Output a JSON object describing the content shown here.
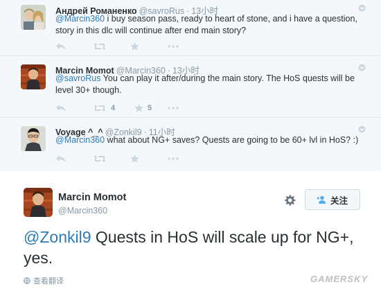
{
  "replies": [
    {
      "fullname": "Андрей Романенко",
      "handle": "@savroRus",
      "time": "13小时",
      "mention": "@Marcin360",
      "text": " i buy season pass, ready to heart of stone, and i have a question, story in this dlc will continue after end main story?",
      "retweets": "",
      "favorites": ""
    },
    {
      "fullname": "Marcin Momot",
      "handle": "@Marcin360",
      "time": "13小时",
      "mention": "@savroRus",
      "text": " You can play it after/during the main story. The HoS quests will be level 30+ though.",
      "retweets": "4",
      "favorites": "5"
    },
    {
      "fullname": "Voyage ^_^",
      "handle": "@Zonkil9",
      "time": "11小时",
      "mention": "@Marcin360",
      "text": " what about NG+ saves? Quests are going to be 60+ lvl in HoS? :)",
      "retweets": "",
      "favorites": ""
    }
  ],
  "main_tweet": {
    "fullname": "Marcin Momot",
    "handle": "@Marcin360",
    "follow_label": "关注",
    "mention": "@Zonkil9",
    "text": " Quests in HoS will scale up for NG+, yes.",
    "translate_label": "查看翻译"
  },
  "watermark": "GAMERSKY",
  "colors": {
    "link": "#2b7bb9",
    "muted": "#8899a6",
    "icon": "#aab8c2",
    "thread_bg": "#f5f8fa"
  },
  "icons": {
    "reply": "reply-icon",
    "retweet": "retweet-icon",
    "favorite": "star-icon",
    "more": "more-icon",
    "caret": "chevron-down-icon",
    "gear": "gear-icon",
    "follow": "follow-user-icon",
    "globe": "globe-icon"
  }
}
